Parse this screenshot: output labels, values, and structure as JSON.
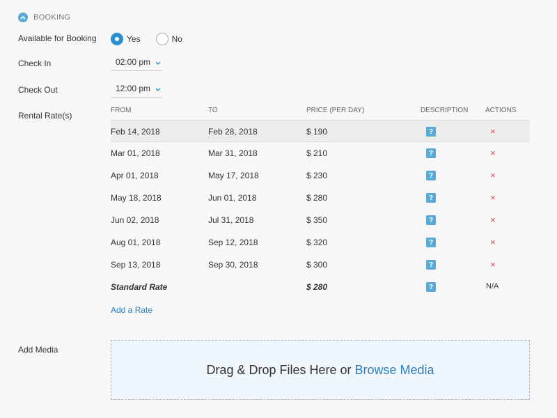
{
  "section": {
    "title": "BOOKING",
    "icon": "chevron-up-icon"
  },
  "availability": {
    "label": "Available for Booking",
    "options": [
      {
        "label": "Yes",
        "checked": true
      },
      {
        "label": "No",
        "checked": false
      }
    ]
  },
  "check_in": {
    "label": "Check In",
    "value": "02:00 pm"
  },
  "check_out": {
    "label": "Check Out",
    "value": "12:00 pm"
  },
  "rates": {
    "label": "Rental Rate(s)",
    "columns": {
      "from": "FROM",
      "to": "TO",
      "price": "PRICE (PER DAY)",
      "description": "DESCRIPTION",
      "actions": "ACTIONS"
    },
    "rows": [
      {
        "from": "Feb 14, 2018",
        "to": "Feb 28, 2018",
        "price": "$ 190"
      },
      {
        "from": "Mar 01, 2018",
        "to": "Mar 31, 2018",
        "price": "$ 210"
      },
      {
        "from": "Apr 01, 2018",
        "to": "May 17, 2018",
        "price": "$ 230"
      },
      {
        "from": "May 18, 2018",
        "to": "Jun 01, 2018",
        "price": "$ 280"
      },
      {
        "from": "Jun 02, 2018",
        "to": "Jul 31, 2018",
        "price": "$ 350"
      },
      {
        "from": "Aug 01, 2018",
        "to": "Sep 12, 2018",
        "price": "$ 320"
      },
      {
        "from": "Sep 13, 2018",
        "to": "Sep 30, 2018",
        "price": "$ 300"
      }
    ],
    "standard": {
      "label": "Standard Rate",
      "price": "$ 280",
      "actions": "N/A"
    },
    "desc_glyph": "?",
    "delete_glyph": "×",
    "add_label": "Add a Rate"
  },
  "media": {
    "label": "Add Media",
    "drop_text": "Drag & Drop Files Here or",
    "browse_label": "Browse Media"
  },
  "colors": {
    "accent": "#2b8fd2",
    "link": "#2b7fc0",
    "delete": "#d9534f",
    "icon_bg": "#5aaad8"
  }
}
